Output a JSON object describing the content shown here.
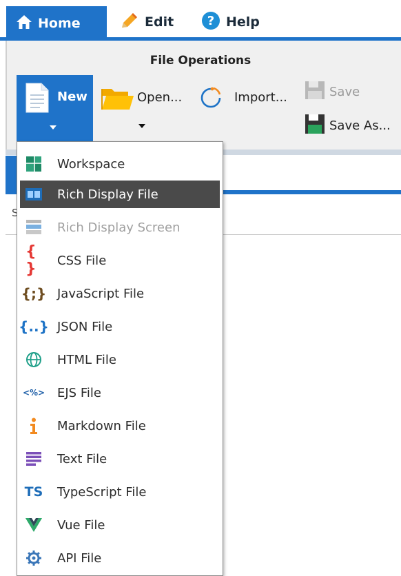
{
  "tabs": [
    {
      "label": "Home",
      "icon": "home-icon",
      "active": true
    },
    {
      "label": "Edit",
      "icon": "pencil-icon"
    },
    {
      "label": "Help",
      "icon": "help-icon"
    }
  ],
  "ribbon": {
    "group_title": "File Operations",
    "new_label": "New",
    "open_label": "Open...",
    "import_label": "Import...",
    "save_label": "Save",
    "save_as_label": "Save As..."
  },
  "background": {
    "left_char": "S"
  },
  "menu": {
    "items": [
      {
        "label": "Workspace",
        "icon": "workspace-icon"
      },
      {
        "label": "Rich Display File",
        "icon": "rich-display-icon",
        "selected": true
      },
      {
        "label": "Rich Display Screen",
        "icon": "rich-screen-icon",
        "disabled": true
      },
      {
        "label": "CSS File",
        "icon": "css-braces-icon"
      },
      {
        "label": "JavaScript File",
        "icon": "js-braces-icon"
      },
      {
        "label": "JSON File",
        "icon": "json-braces-icon"
      },
      {
        "label": "HTML File",
        "icon": "globe-icon"
      },
      {
        "label": "EJS File",
        "icon": "ejs-icon"
      },
      {
        "label": "Markdown File",
        "icon": "info-icon"
      },
      {
        "label": "Text File",
        "icon": "text-lines-icon"
      },
      {
        "label": "TypeScript File",
        "icon": "ts-icon"
      },
      {
        "label": "Vue File",
        "icon": "vue-icon"
      },
      {
        "label": "API File",
        "icon": "gear-icon"
      }
    ]
  },
  "colors": {
    "accent": "#1f73c9",
    "selected_row": "#4a4a4a",
    "disabled_text": "#a0a0a0"
  }
}
